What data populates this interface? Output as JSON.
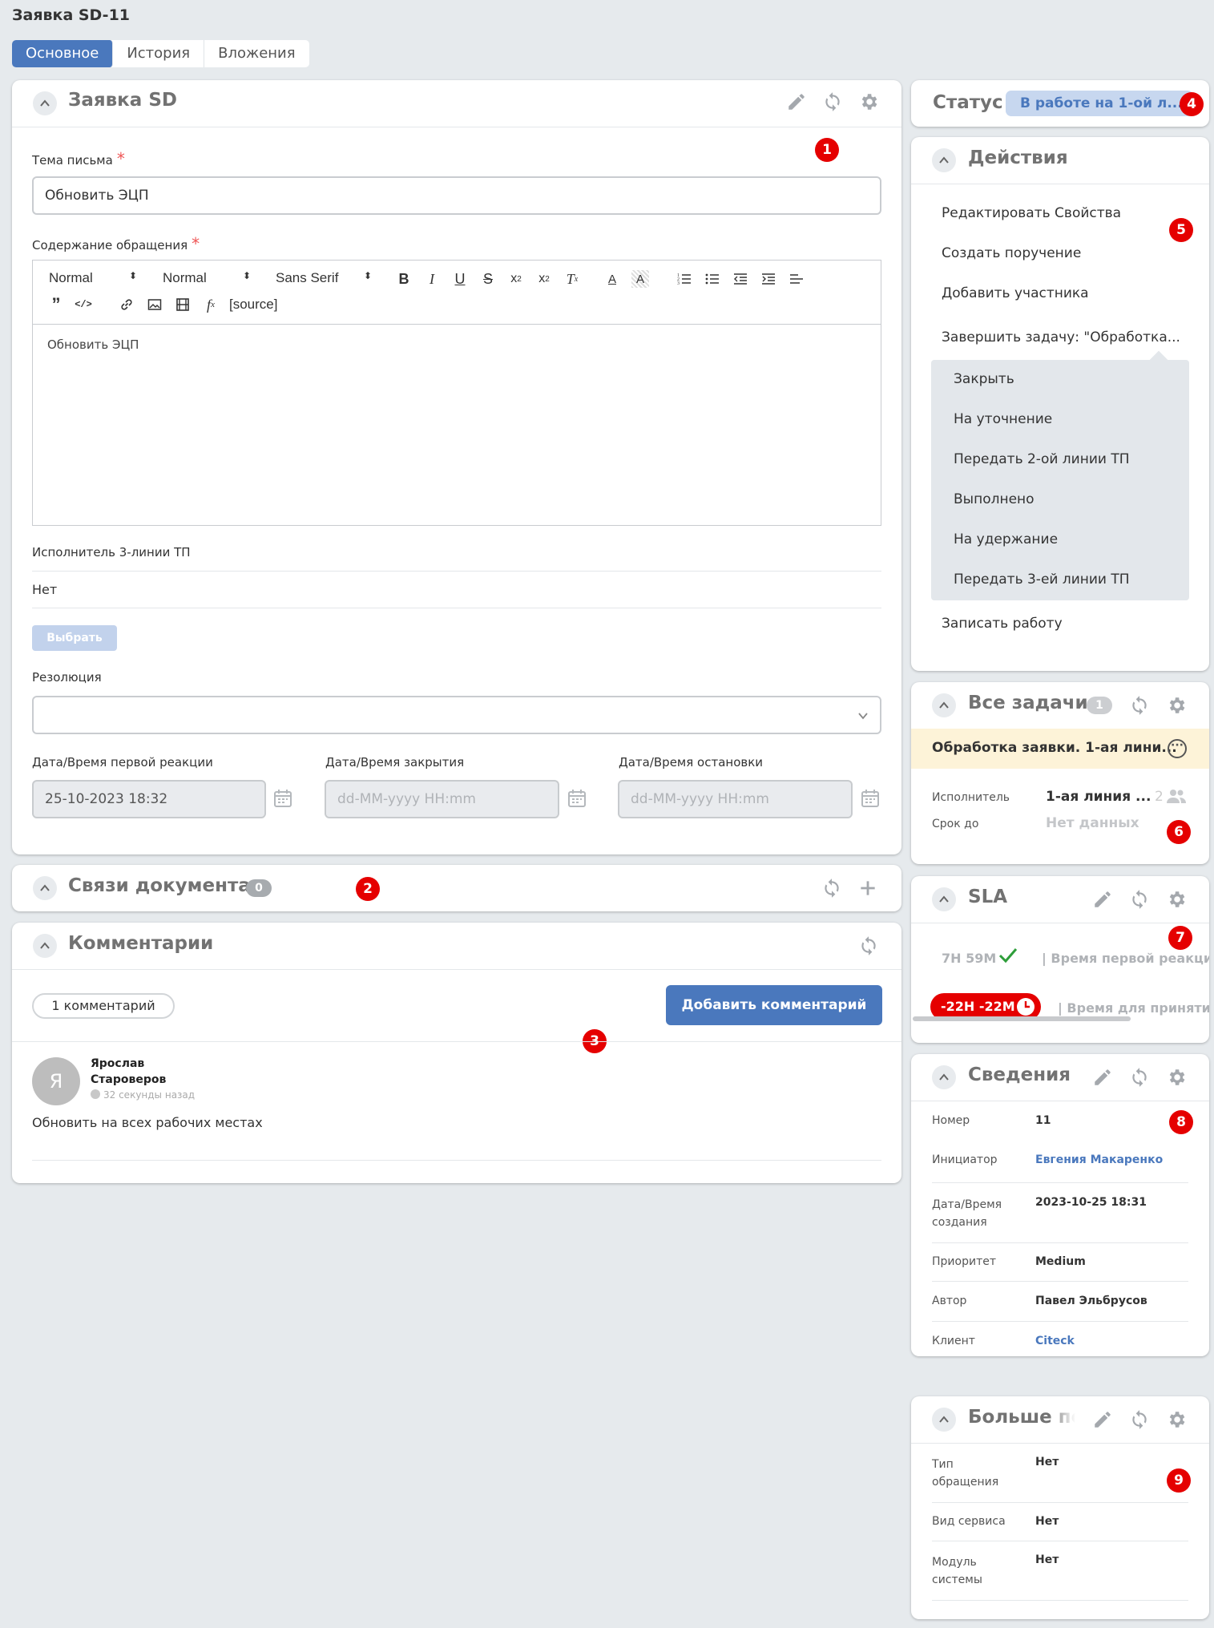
{
  "page": {
    "title": "Заявка SD-11"
  },
  "tabs": [
    {
      "label": "Основное"
    },
    {
      "label": "История"
    },
    {
      "label": "Вложения"
    }
  ],
  "request_card": {
    "title": "Заявка SD",
    "subject_label": "Тема письма",
    "subject_value": "Обновить ЭЦП",
    "content_label": "Содержание обращения",
    "editor": {
      "format_select": "Normal",
      "size_select": "Normal",
      "font_select": "Sans Serif",
      "source_label": "[source]",
      "body_text": "Обновить ЭЦП"
    },
    "executor_label": "Исполнитель 3-линии ТП",
    "executor_value": "Нет",
    "select_button": "Выбрать",
    "resolution_label": "Резолюция",
    "first_reaction_label": "Дата/Время первой реакции",
    "first_reaction_value": "25-10-2023 18:32",
    "close_label": "Дата/Время закрытия",
    "close_placeholder": "dd-MM-yyyy HH:mm",
    "stop_label": "Дата/Время остановки",
    "stop_placeholder": "dd-MM-yyyy HH:mm"
  },
  "links_card": {
    "title": "Связи документа",
    "count": "0"
  },
  "comments_card": {
    "title": "Комментарии",
    "count_label": "1 комментарий",
    "add_button": "Добавить комментарий",
    "comment": {
      "avatar_letter": "Я",
      "author_first": "Ярослав",
      "author_last": "Староверов",
      "time": "32 секунды назад",
      "text": "Обновить на всех рабочих местах"
    }
  },
  "status_card": {
    "label": "Статус",
    "value": "В работе на 1-ой л..."
  },
  "actions_card": {
    "title": "Действия",
    "items": [
      {
        "label": "Редактировать Свойства"
      },
      {
        "label": "Создать поручение"
      },
      {
        "label": "Добавить участника"
      },
      {
        "label": "Завершить задачу: \"Обработка..."
      }
    ],
    "submenu": [
      {
        "label": "Закрыть"
      },
      {
        "label": "На уточнение"
      },
      {
        "label": "Передать 2-ой линии ТП"
      },
      {
        "label": "Выполнено"
      },
      {
        "label": "На удержание"
      },
      {
        "label": "Передать 3-ей линии ТП"
      }
    ],
    "last_item": "Записать работу"
  },
  "tasks_card": {
    "title": "Все задачи",
    "count": "1",
    "task_title": "Обработка заявки. 1-ая лини...",
    "executor_label": "Исполнитель",
    "executor_value": "1-ая линия ...",
    "executor_count": "2",
    "due_label": "Срок до",
    "due_value": "Нет данных"
  },
  "sla_card": {
    "title": "SLA",
    "row1_time": "7H 59M",
    "row1_label": "| Время первой реакци",
    "row2_time": "-22H -22M",
    "row2_label": "| Время для приняти"
  },
  "info_card": {
    "title": "Сведения",
    "rows": [
      {
        "label": "Номер",
        "value": "11"
      },
      {
        "label": "Инициатор",
        "value": "Евгения Макаренко"
      },
      {
        "label": "Дата/Время создания",
        "value": "2023-10-25 18:31"
      },
      {
        "label": "Приоритет",
        "value": "Medium"
      },
      {
        "label": "Автор",
        "value": "Павел Эльбрусов"
      },
      {
        "label": "Клиент",
        "value": "Citeck"
      }
    ]
  },
  "more_card": {
    "title": "Больше по",
    "rows": [
      {
        "label": "Тип обращения",
        "value": "Нет"
      },
      {
        "label": "Вид сервиса",
        "value": "Нет"
      },
      {
        "label": "Модуль системы",
        "value": "Нет"
      }
    ]
  },
  "markers": [
    "1",
    "2",
    "3",
    "4",
    "5",
    "6",
    "7",
    "8",
    "9"
  ],
  "colors": {
    "accent": "#4a78bd",
    "marker": "#e50000",
    "sla_overdue": "#e50000",
    "sla_ok": "#2e9e3a",
    "status_bg": "#c7d7ef"
  }
}
